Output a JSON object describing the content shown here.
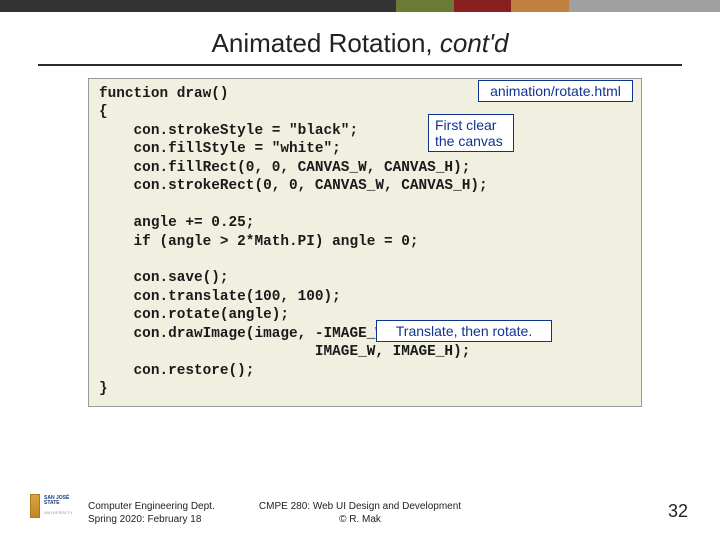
{
  "title": {
    "main": "Animated Rotation, ",
    "cont": "cont'd"
  },
  "labels": {
    "file": "animation/rotate.html",
    "clear": "First clear the canvas",
    "translate": "Translate, then rotate."
  },
  "code": "function draw()\n{\n    con.strokeStyle = \"black\";\n    con.fillStyle = \"white\";\n    con.fillRect(0, 0, CANVAS_W, CANVAS_H);\n    con.strokeRect(0, 0, CANVAS_W, CANVAS_H);\n\n    angle += 0.25;\n    if (angle > 2*Math.PI) angle = 0;\n\n    con.save();\n    con.translate(100, 100);\n    con.rotate(angle);\n    con.drawImage(image, -IMAGE_W/2, -IMAGE_H/2,\n                         IMAGE_W, IMAGE_H);\n    con.restore();\n}",
  "footer": {
    "left1": "Computer Engineering Dept.",
    "left2": "Spring 2020: February 18",
    "center1": "CMPE 280: Web UI Design and Development",
    "center2": "© R. Mak",
    "page": "32"
  },
  "logo": {
    "line1": "SAN JOSÉ STATE",
    "line2": "UNIVERSITY"
  }
}
